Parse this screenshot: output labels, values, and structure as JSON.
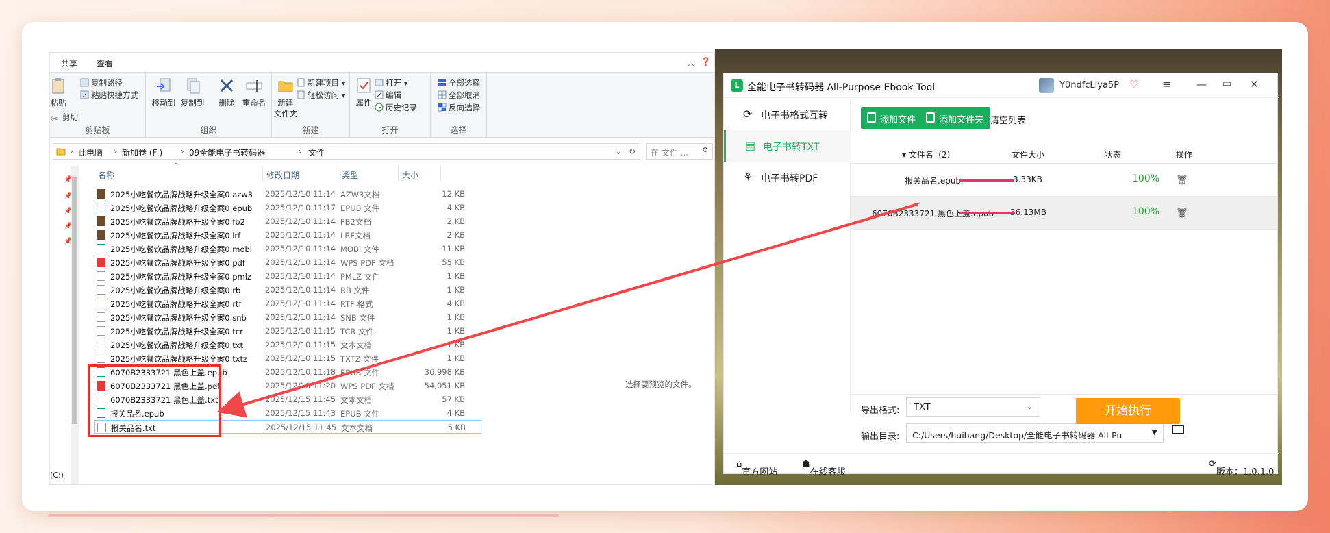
{
  "explorer": {
    "tabs": [
      "共享",
      "查看"
    ],
    "ribbon": {
      "clipboard": {
        "paste": "粘贴",
        "copy_path": "复制路径",
        "paste_shortcut": "粘贴快捷方式",
        "cut": "剪切",
        "title": "剪贴板"
      },
      "organize": {
        "move_to": "移动到",
        "copy_to": "复制到",
        "delete": "删除",
        "rename": "重命名",
        "title": "组织"
      },
      "new": {
        "new_folder_l1": "新建",
        "new_folder_l2": "文件夹",
        "new_item": "新建项目",
        "easy_access": "轻松访问",
        "title": "新建"
      },
      "open": {
        "properties": "属性",
        "open": "打开",
        "edit": "编辑",
        "history": "历史记录",
        "title": "打开"
      },
      "select": {
        "select_all": "全部选择",
        "select_none": "全部取消",
        "invert": "反向选择",
        "title": "选择"
      }
    },
    "address": {
      "crumbs": [
        "此电脑",
        "新加卷 (F:)",
        "09全能电子书转码器",
        "文件"
      ],
      "search_placeholder": "在 文件 ..."
    },
    "columns": {
      "name": "名称",
      "date": "修改日期",
      "type": "类型",
      "size": "大小"
    },
    "drives": [
      "(C:)",
      "):)",
      ":)",
      ":)"
    ],
    "files": [
      {
        "name": "2025小吃餐饮品牌战略升级全案0.azw3",
        "date": "2025/12/10 11:14",
        "type": "AZW3文档",
        "size": "12 KB",
        "icon": "azw3"
      },
      {
        "name": "2025小吃餐饮品牌战略升级全案0.epub",
        "date": "2025/12/10 11:17",
        "type": "EPUB 文件",
        "size": "4 KB",
        "icon": "epub"
      },
      {
        "name": "2025小吃餐饮品牌战略升级全案0.fb2",
        "date": "2025/12/10 11:14",
        "type": "FB2文档",
        "size": "2 KB",
        "icon": "fb2"
      },
      {
        "name": "2025小吃餐饮品牌战略升级全案0.lrf",
        "date": "2025/12/10 11:14",
        "type": "LRF文档",
        "size": "2 KB",
        "icon": "lrf"
      },
      {
        "name": "2025小吃餐饮品牌战略升级全案0.mobi",
        "date": "2025/12/10 11:14",
        "type": "MOBI 文件",
        "size": "11 KB",
        "icon": "mobi"
      },
      {
        "name": "2025小吃餐饮品牌战略升级全案0.pdf",
        "date": "2025/12/10 11:14",
        "type": "WPS PDF 文档",
        "size": "55 KB",
        "icon": "pdf"
      },
      {
        "name": "2025小吃餐饮品牌战略升级全案0.pmlz",
        "date": "2025/12/10 11:14",
        "type": "PMLZ 文件",
        "size": "1 KB",
        "icon": "txt"
      },
      {
        "name": "2025小吃餐饮品牌战略升级全案0.rb",
        "date": "2025/12/10 11:14",
        "type": "RB 文件",
        "size": "1 KB",
        "icon": "txt"
      },
      {
        "name": "2025小吃餐饮品牌战略升级全案0.rtf",
        "date": "2025/12/10 11:14",
        "type": "RTF 格式",
        "size": "4 KB",
        "icon": "rtf"
      },
      {
        "name": "2025小吃餐饮品牌战略升级全案0.snb",
        "date": "2025/12/10 11:14",
        "type": "SNB 文件",
        "size": "1 KB",
        "icon": "txt"
      },
      {
        "name": "2025小吃餐饮品牌战略升级全案0.tcr",
        "date": "2025/12/10 11:15",
        "type": "TCR 文件",
        "size": "1 KB",
        "icon": "txt"
      },
      {
        "name": "2025小吃餐饮品牌战略升级全案0.txt",
        "date": "2025/12/10 11:15",
        "type": "文本文档",
        "size": "1 KB",
        "icon": "txt"
      },
      {
        "name": "2025小吃餐饮品牌战略升级全案0.txtz",
        "date": "2025/12/10 11:15",
        "type": "TXTZ 文件",
        "size": "1 KB",
        "icon": "txt"
      },
      {
        "name": "6070B2333721 黑色上盖.epub",
        "date": "2025/12/10 11:18",
        "type": "EPUB 文件",
        "size": "36,998 KB",
        "icon": "epub"
      },
      {
        "name": "6070B2333721 黑色上盖.pdf",
        "date": "2025/12/10 11:20",
        "type": "WPS PDF 文档",
        "size": "54,051 KB",
        "icon": "pdf"
      },
      {
        "name": "6070B2333721 黑色上盖.txt",
        "date": "2025/12/15 11:45",
        "type": "文本文档",
        "size": "57 KB",
        "icon": "txt"
      },
      {
        "name": "报关品名.epub",
        "date": "2025/12/15 11:43",
        "type": "EPUB 文件",
        "size": "4 KB",
        "icon": "epub"
      },
      {
        "name": "报关品名.txt",
        "date": "2025/12/15 11:45",
        "type": "文本文档",
        "size": "5 KB",
        "icon": "txt"
      }
    ],
    "preview_hint": "选择要预览的文件。"
  },
  "app": {
    "title": "全能电子书转码器 All-Purpose Ebook Tool",
    "user": "Y0ndfcLlya5P",
    "nav": [
      {
        "label": "电子书格式互转",
        "icon": "sync-icon"
      },
      {
        "label": "电子书转TXT",
        "icon": "document-icon"
      },
      {
        "label": "电子书转PDF",
        "icon": "pdf-icon"
      }
    ],
    "toolbar": {
      "add_file": "添加文件",
      "add_folder": "添加文件夹",
      "clear_list": "清空列表"
    },
    "table": {
      "header": {
        "name": "▾ 文件名（2）",
        "size": "文件大小",
        "status": "状态",
        "action": "操作"
      },
      "rows": [
        {
          "name": "报关品名.epub",
          "size": "3.33KB",
          "progress": 100,
          "percent": "100%"
        },
        {
          "name": "6070B2333721 黑色上盖.epub",
          "size": "36.13MB",
          "progress": 100,
          "percent": "100%"
        }
      ]
    },
    "output": {
      "format_label": "导出格式:",
      "format_value": "TXT",
      "dir_label": "输出目录:",
      "dir_value": "C:/Users/huibang/Desktop/全能电子书转码器 All-Pu"
    },
    "start_button": "开始执行",
    "footer": {
      "website": "官方网站",
      "support": "在线客服",
      "version": "版本：1.0.1.0"
    }
  },
  "colors": {
    "accent_green": "#1aae5f",
    "start_orange": "#ff9a0a",
    "highlight_red": "#e5322d",
    "progress_pink": "#e5336b"
  }
}
